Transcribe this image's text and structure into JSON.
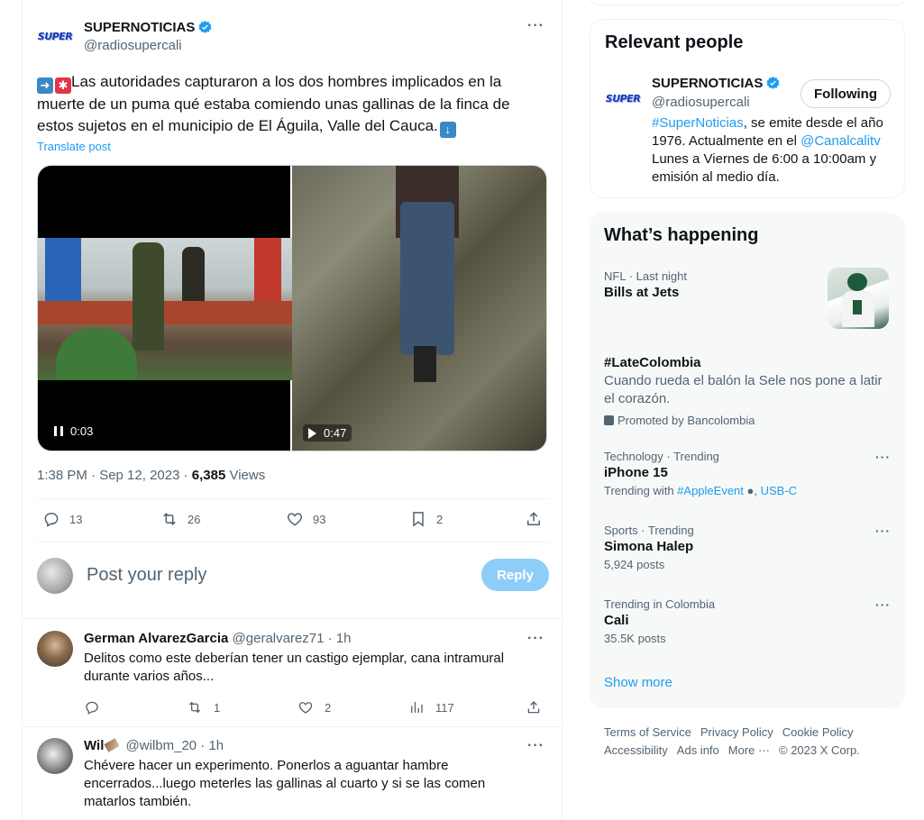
{
  "tweet": {
    "author_name": "SUPERNOTICIAS",
    "author_handle": "@radiosupercali",
    "logo_text": "SUPER",
    "text_line1": "Las autoridades capturaron a los dos hombres implicados en la",
    "text_line2": "muerte de un puma qué estaba comiendo unas gallinas de la finca de",
    "text_line3": "estos sujetos en  el municipio de El Águila, Valle del Cauca.",
    "translate_label": "Translate post",
    "video1_time": "0:03",
    "video2_time": "0:47",
    "time": "1:38 PM · Sep 12, 2023 · ",
    "views_count": "6,385",
    "views_label": " Views",
    "replies": "13",
    "retweets": "26",
    "likes": "93",
    "bookmarks": "2"
  },
  "reply_composer": {
    "placeholder": "Post your reply",
    "button_label": "Reply"
  },
  "replies": [
    {
      "name": "German AlvarezGarcia",
      "handle": "@geralvarez71 · 1h",
      "text": "Delitos como este deberían tener un castigo ejemplar, cana intramural durante varios años...",
      "replies": "",
      "retweets": "1",
      "likes": "2",
      "views": "117"
    },
    {
      "name": "Wil",
      "handle": "@wilbm_20 · 1h",
      "text": "Chévere hacer un experimento. Ponerlos a aguantar hambre encerrados...luego meterles las gallinas al cuarto y si se las comen matarlos también."
    }
  ],
  "relevant_people": {
    "title": "Relevant people",
    "name": "SUPERNOTICIAS",
    "handle": "@radiosupercali",
    "follow_label": "Following",
    "bio_hashtag": "#SuperNoticias",
    "bio_part1": ", se emite desde el año 1976. Actualmente en el ",
    "bio_mention": "@Canalcalitv",
    "bio_part2": " Lunes a Viernes de 6:00 a 10:00am y emisión al medio día."
  },
  "happening": {
    "title": "What’s happening",
    "trends": [
      {
        "meta": "NFL · Last night",
        "title": "Bills at Jets"
      },
      {
        "meta": "",
        "title": "#LateColombia",
        "desc": "Cuando rueda el balón la Sele nos pone a latir el corazón.",
        "promo": "Promoted by Bancolombia"
      },
      {
        "meta": "Technology · Trending",
        "title": "iPhone 15",
        "sub_prefix": "Trending with ",
        "sub_link1": "#AppleEvent",
        "sub_link2": "USB-C"
      },
      {
        "meta": "Sports · Trending",
        "title": "Simona Halep",
        "sub": "5,924 posts"
      },
      {
        "meta": "Trending in Colombia",
        "title": "Cali",
        "sub": "35.5K posts"
      }
    ],
    "show_more": "Show more"
  },
  "footer": {
    "links": [
      "Terms of Service",
      "Privacy Policy",
      "Cookie Policy",
      "Accessibility",
      "Ads info",
      "More ···",
      "© 2023 X Corp."
    ]
  }
}
